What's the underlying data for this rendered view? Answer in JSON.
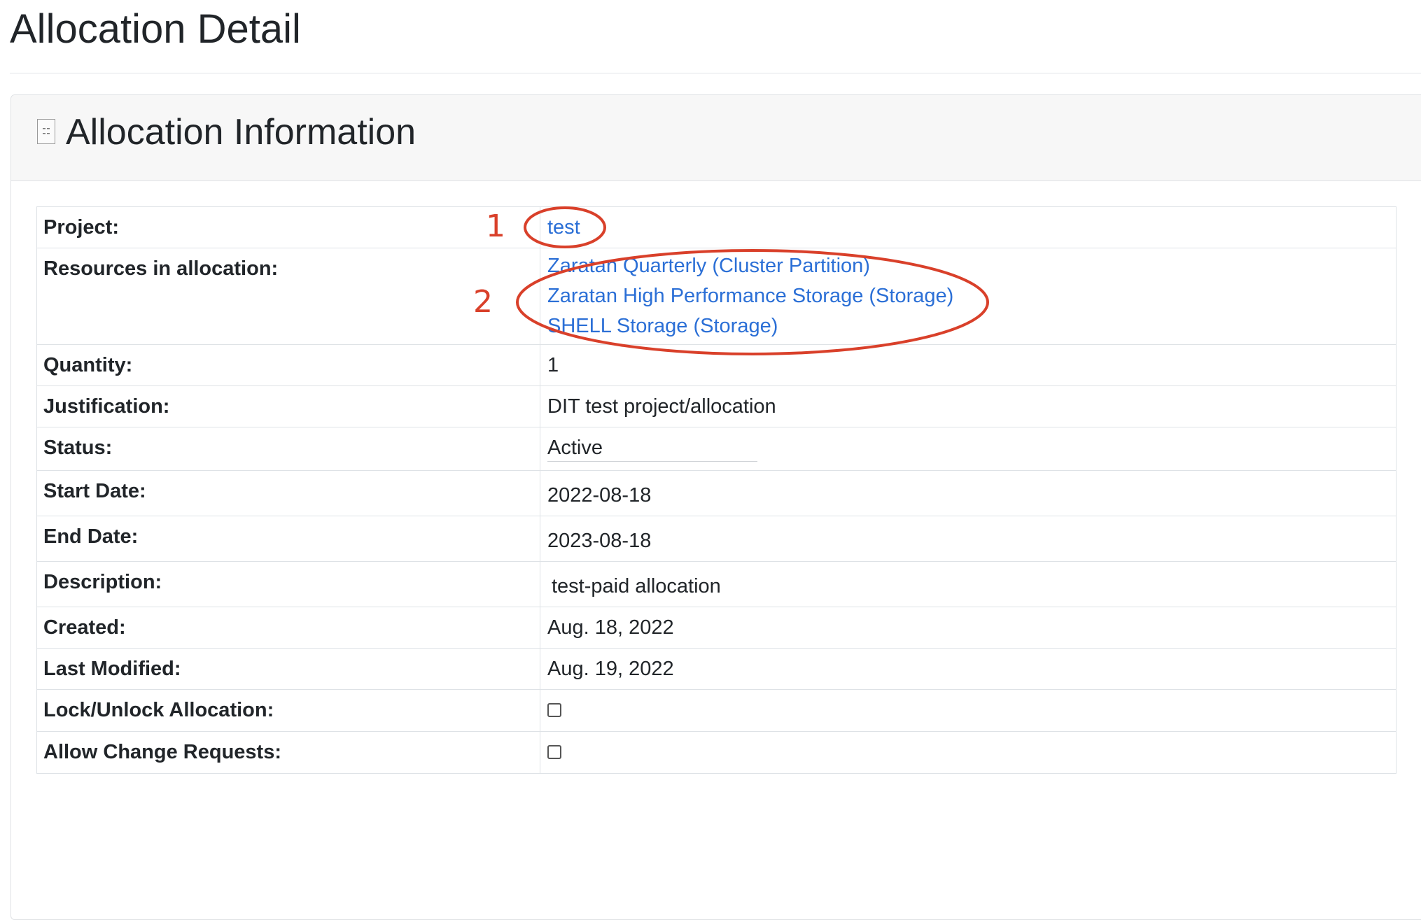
{
  "page": {
    "title": "Allocation Detail"
  },
  "card": {
    "title": "Allocation Information",
    "icon": "document-icon"
  },
  "rows": {
    "project": {
      "label": "Project:",
      "value": "test"
    },
    "resources": {
      "label": "Resources in allocation:",
      "items": [
        "Zaratan Quarterly (Cluster Partition)",
        "Zaratan High Performance Storage (Storage)",
        "SHELL Storage (Storage)"
      ]
    },
    "quantity": {
      "label": "Quantity:",
      "value": "1"
    },
    "justification": {
      "label": "Justification:",
      "value": "DIT test project/allocation"
    },
    "status": {
      "label": "Status:",
      "value": "Active"
    },
    "start_date": {
      "label": "Start Date:",
      "value": "2022-08-18"
    },
    "end_date": {
      "label": "End Date:",
      "value": "2023-08-18"
    },
    "description": {
      "label": "Description:",
      "value": "test-paid allocation"
    },
    "created": {
      "label": "Created:",
      "value": "Aug. 18, 2022"
    },
    "last_modified": {
      "label": "Last Modified:",
      "value": "Aug. 19, 2022"
    },
    "lock_unlock": {
      "label": "Lock/Unlock Allocation:",
      "checked": false
    },
    "allow_change": {
      "label": "Allow Change Requests:",
      "checked": false
    }
  },
  "annotations": {
    "marker1": "1",
    "marker2": "2",
    "color": "#d9402a"
  },
  "colors": {
    "link": "#2b6fd6",
    "header_bg": "#f7f7f7",
    "border": "#dee2e6"
  }
}
